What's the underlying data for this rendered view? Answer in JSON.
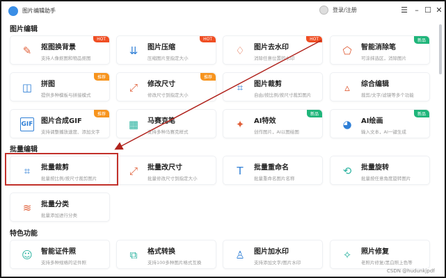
{
  "app": {
    "title": "图片编辑助手",
    "login": "登录/注册",
    "menu_icon": "menu-icon",
    "min_icon": "minimize-icon",
    "max_icon": "maximize-icon",
    "close_icon": "close-icon"
  },
  "colors": {
    "hot": "#f04e23",
    "recommend": "#f7941d",
    "new": "#1fb57a",
    "highlight": "#c2302a",
    "arrow": "#b0231d"
  },
  "sections": [
    {
      "title": "图片编辑",
      "cards": [
        {
          "title": "抠图换背景",
          "desc": "支持人像抠图和物品抠图",
          "badge": "HOT",
          "badge_type": "hot",
          "icon": "eraser-icon",
          "glyph": "✎",
          "color": "#e0603a"
        },
        {
          "title": "图片压缩",
          "desc": "压缩图片至指定大小",
          "badge": "HOT",
          "badge_type": "hot",
          "icon": "compress-icon",
          "glyph": "⇊",
          "color": "#2f7fd6"
        },
        {
          "title": "图片去水印",
          "desc": "消除任意位置的水印",
          "badge": "HOT",
          "badge_type": "hot",
          "icon": "drop-slash-icon",
          "glyph": "♢",
          "color": "#e0603a"
        },
        {
          "title": "智能消除笔",
          "desc": "可涂抹选区，消除图片",
          "badge": "新品",
          "badge_type": "new",
          "icon": "eraser-pen-icon",
          "glyph": "⬠",
          "color": "#e0603a"
        },
        {
          "title": "拼图",
          "desc": "提供多种模板与拼接模式",
          "badge": "推荐",
          "badge_type": "recommend",
          "icon": "collage-icon",
          "glyph": "◫",
          "color": "#2f7fd6"
        },
        {
          "title": "修改尺寸",
          "desc": "修改尺寸到指定大小",
          "badge": "推荐",
          "badge_type": "recommend",
          "icon": "resize-icon",
          "glyph": "⤢",
          "color": "#e0603a"
        },
        {
          "title": "图片裁剪",
          "desc": "自由/按比例/按尺寸裁剪图片",
          "badge": "",
          "badge_type": "",
          "icon": "crop-icon",
          "glyph": "⌗",
          "color": "#2f7fd6"
        },
        {
          "title": "综合编辑",
          "desc": "裁剪/文字/滤镜等多个功能",
          "badge": "",
          "badge_type": "",
          "icon": "shapes-icon",
          "glyph": "▵",
          "color": "#e0603a"
        },
        {
          "title": "图片合成GIF",
          "desc": "支持调整播放速度、添加文字",
          "badge": "推荐",
          "badge_type": "recommend",
          "icon": "gif-icon",
          "glyph": "GIF",
          "color": "#2f7fd6"
        },
        {
          "title": "马赛克笔",
          "desc": "支持多种马赛克样式",
          "badge": "",
          "badge_type": "",
          "icon": "mosaic-icon",
          "glyph": "▦",
          "color": "#2bb3a0"
        },
        {
          "title": "AI特效",
          "desc": "创作图片，AI以图绘图",
          "badge": "新品",
          "badge_type": "new",
          "icon": "sparkle-icon",
          "glyph": "✦",
          "color": "#e0603a"
        },
        {
          "title": "AI绘画",
          "desc": "输入文本，AI一键生成",
          "badge": "新品",
          "badge_type": "new",
          "icon": "palette-icon",
          "glyph": "◕",
          "color": "#2f7fd6"
        }
      ]
    },
    {
      "title": "批量编辑",
      "cards": [
        {
          "title": "批量裁剪",
          "desc": "批量按比例/按尺寸裁剪图片",
          "badge": "",
          "badge_type": "",
          "icon": "batch-crop-icon",
          "glyph": "⌗",
          "color": "#2f7fd6"
        },
        {
          "title": "批量改尺寸",
          "desc": "批量修改尺寸到指定大小",
          "badge": "",
          "badge_type": "",
          "icon": "batch-resize-icon",
          "glyph": "⤢",
          "color": "#e0603a"
        },
        {
          "title": "批量重命名",
          "desc": "批量重命名图片名称",
          "badge": "",
          "badge_type": "",
          "icon": "rename-icon",
          "glyph": "T",
          "color": "#2f7fd6"
        },
        {
          "title": "批量旋转",
          "desc": "批量按任意角度旋转图片",
          "badge": "",
          "badge_type": "",
          "icon": "rotate-icon",
          "glyph": "⟲",
          "color": "#2bb3a0"
        },
        {
          "title": "批量分类",
          "desc": "批量添加进行分类",
          "badge": "",
          "badge_type": "",
          "icon": "layers-icon",
          "glyph": "≋",
          "color": "#e0603a"
        }
      ]
    },
    {
      "title": "特色功能",
      "cards": [
        {
          "title": "智能证件照",
          "desc": "支持多种规格的证件照",
          "badge": "",
          "badge_type": "",
          "icon": "id-photo-icon",
          "glyph": "☺",
          "color": "#2bb3a0"
        },
        {
          "title": "格式转换",
          "desc": "支持100多种图片格式互换",
          "badge": "",
          "badge_type": "",
          "icon": "convert-icon",
          "glyph": "⧉",
          "color": "#2bb3a0"
        },
        {
          "title": "图片加水印",
          "desc": "支持添加文字/图片水印",
          "badge": "",
          "badge_type": "",
          "icon": "stamp-icon",
          "glyph": "♙",
          "color": "#2f7fd6"
        },
        {
          "title": "照片修复",
          "desc": "老照片修复/黑白照上色等",
          "badge": "",
          "badge_type": "",
          "icon": "magic-wand-icon",
          "glyph": "✧",
          "color": "#2bb3a0"
        }
      ]
    }
  ],
  "watermark": "CSDN @hudunkjpdf"
}
